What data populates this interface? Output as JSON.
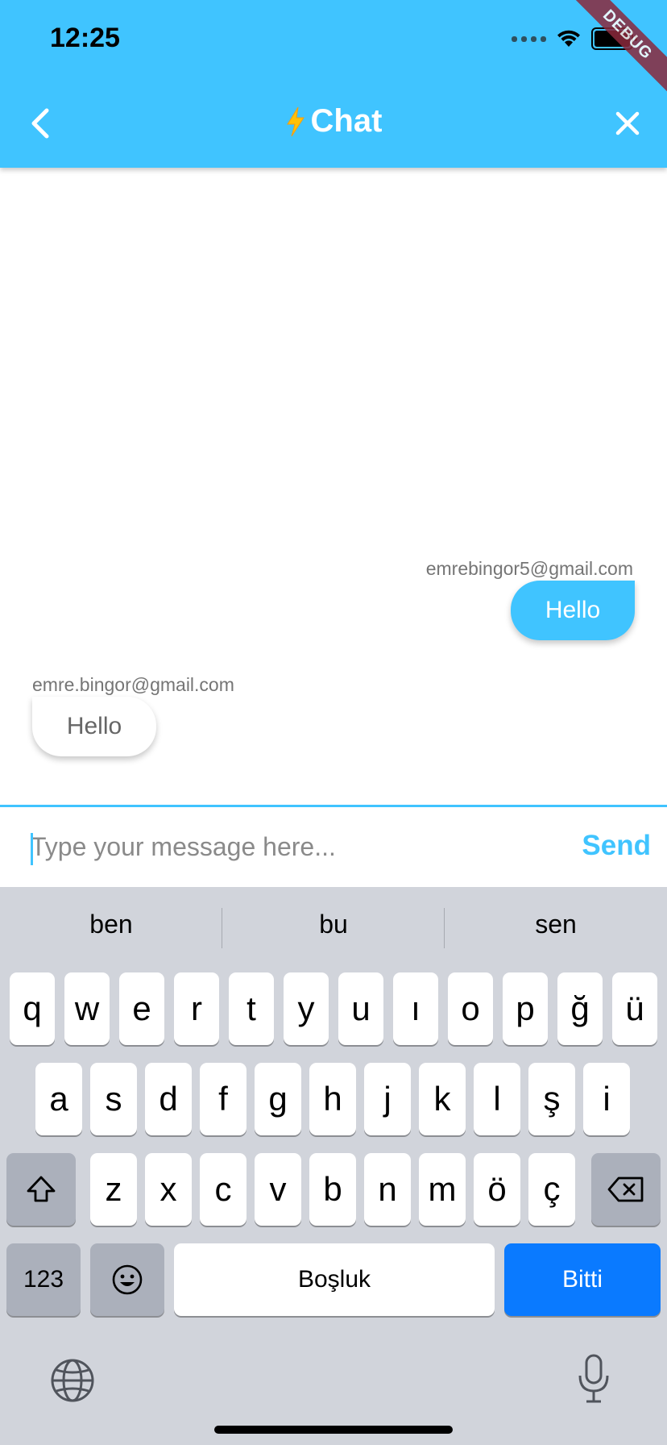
{
  "status_bar": {
    "time": "12:25"
  },
  "debug_banner": "DEBUG",
  "appbar": {
    "title_emoji": "⚡",
    "title": "Chat"
  },
  "messages": [
    {
      "sender": "emrebingor5@gmail.com",
      "text": "Hello",
      "is_me": true
    },
    {
      "sender": "emre.bingor@gmail.com",
      "text": "Hello",
      "is_me": false
    }
  ],
  "input": {
    "placeholder": "Type your message here...",
    "value": "",
    "send_label": "Send"
  },
  "keyboard": {
    "suggestions": [
      "ben",
      "bu",
      "sen"
    ],
    "row1": [
      "q",
      "w",
      "e",
      "r",
      "t",
      "y",
      "u",
      "ı",
      "o",
      "p",
      "ğ",
      "ü"
    ],
    "row2": [
      "a",
      "s",
      "d",
      "f",
      "g",
      "h",
      "j",
      "k",
      "l",
      "ş",
      "i"
    ],
    "row3": [
      "z",
      "x",
      "c",
      "v",
      "b",
      "n",
      "m",
      "ö",
      "ç"
    ],
    "numbers_label": "123",
    "space_label": "Boşluk",
    "done_label": "Bitti"
  },
  "colors": {
    "accent": "#40c4ff",
    "keyboard_bg": "#d1d4db",
    "done_key": "#0a7aff"
  }
}
